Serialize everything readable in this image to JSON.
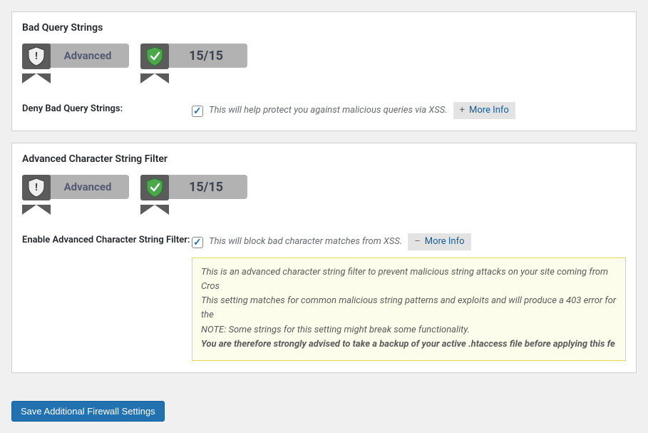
{
  "panels": [
    {
      "title": "Bad Query Strings",
      "badges": {
        "level": "Advanced",
        "score": "15/15"
      },
      "setting": {
        "label": "Deny Bad Query Strings:",
        "description": "This will help protect you against malicious queries via XSS.",
        "more_label": "More Info",
        "more_sign": "+",
        "checked": true
      }
    },
    {
      "title": "Advanced Character String Filter",
      "badges": {
        "level": "Advanced",
        "score": "15/15"
      },
      "setting": {
        "label": "Enable Advanced Character String Filter:",
        "description": "This will block bad character matches from XSS.",
        "more_label": "More Info",
        "more_sign": "–",
        "checked": true,
        "info": {
          "line1": "This is an advanced character string filter to prevent malicious string attacks on your site coming from Cros",
          "line2": "This setting matches for common malicious string patterns and exploits and will produce a 403 error for the",
          "line3": "NOTE: Some strings for this setting might break some functionality.",
          "line4": "You are therefore strongly advised to take a backup of your active .htaccess file before applying this fe"
        }
      }
    }
  ],
  "save_button": "Save Additional Firewall Settings"
}
